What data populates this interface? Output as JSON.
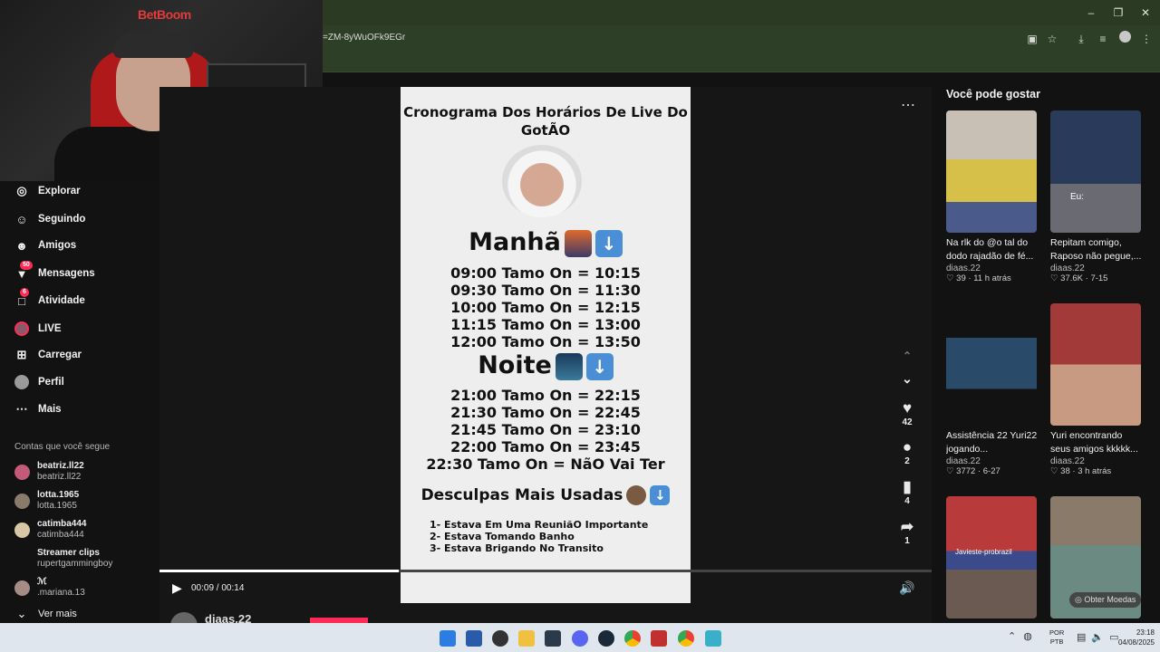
{
  "browser": {
    "url": "=ZM-8yWuOFk9EGr",
    "window_controls": [
      "minimize-icon",
      "restore-icon",
      "close-icon"
    ]
  },
  "webcam": {
    "brand": "BetBoom"
  },
  "sidebar": {
    "items": [
      {
        "label": "Explorar",
        "icon": "compass-icon"
      },
      {
        "label": "Seguindo",
        "icon": "user-follow-icon"
      },
      {
        "label": "Amigos",
        "icon": "friends-icon"
      },
      {
        "label": "Mensagens",
        "icon": "paper-plane-icon",
        "badge": "50"
      },
      {
        "label": "Atividade",
        "icon": "activity-icon",
        "badge": "6"
      },
      {
        "label": "LIVE",
        "icon": "live-icon"
      },
      {
        "label": "Carregar",
        "icon": "upload-icon"
      },
      {
        "label": "Perfil",
        "icon": "profile-icon"
      },
      {
        "label": "Mais",
        "icon": "more-icon"
      }
    ],
    "following_title": "Contas que você segue",
    "accounts": [
      {
        "name": "beatriz.ll22",
        "handle": "beatriz.ll22"
      },
      {
        "name": "lotta.1965",
        "handle": "lotta.1965"
      },
      {
        "name": "catimba444",
        "handle": "catimba444"
      },
      {
        "name": "Streamer clips",
        "handle": "rupertgammingboy"
      },
      {
        "name": "ℳ",
        "handle": ".mariana.13"
      }
    ],
    "see_more": "Ver mais"
  },
  "video": {
    "title": "Cronograma Dos Horários De Live Do GotÃO",
    "morning_heading": "Manhã",
    "morning": [
      "09:00 Tamo On = 10:15",
      "09:30 Tamo On = 11:30",
      "10:00 Tamo On = 12:15",
      "11:15 Tamo On = 13:00",
      "12:00 Tamo On = 13:50"
    ],
    "night_heading": "Noite",
    "night": [
      "21:00 Tamo On = 22:15",
      "21:30 Tamo On = 22:45",
      "21:45 Tamo On = 23:10",
      "22:00 Tamo On = 23:45",
      "22:30 Tamo On = NãO Vai Ter"
    ],
    "excuses_heading": "Desculpas Mais Usadas",
    "excuses": [
      "1- Estava Em Uma ReuniãO Importante",
      "2- Estava Tomando Banho",
      "3- Estava Brigando No Transito"
    ]
  },
  "player": {
    "likes": "42",
    "comments": "2",
    "saves": "4",
    "shares": "1",
    "time": "00:09 / 00:14",
    "progress": 0.31,
    "author": "diaas.22"
  },
  "recommended": {
    "title": "Você pode gostar",
    "items": [
      {
        "caption": "Na rlk do @o tal do dodo rajadão de fé...",
        "user": "diaas.22",
        "likes": "39",
        "age": "11 h atrás",
        "thumb_text": ""
      },
      {
        "caption": "Repitam comigo, Raposo não pegue,...",
        "user": "diaas.22",
        "likes": "37.6K",
        "age": "7-15",
        "thumb_text": "Eu:"
      },
      {
        "caption": "Assistência 22 Yuri22 jogando...",
        "user": "diaas.22",
        "likes": "3772",
        "age": "6-27",
        "thumb_text": ""
      },
      {
        "caption": "Yuri encontrando seus amigos kkkkk...",
        "user": "diaas.22",
        "likes": "38",
        "age": "3 h atrás",
        "thumb_text": ""
      },
      {
        "caption": "",
        "user": "",
        "likes": "",
        "age": "",
        "thumb_text": "Javieste-probrazil"
      },
      {
        "caption": "",
        "user": "",
        "likes": "",
        "age": "",
        "thumb_text": ""
      }
    ],
    "coins": "Obter Moedas"
  },
  "taskbar": {
    "lang": "POR",
    "layout": "PTB",
    "time": "23:18",
    "date": "04/08/2025"
  },
  "colors": {
    "accent": "#fe2c55",
    "chrome": "#2e3f27"
  }
}
